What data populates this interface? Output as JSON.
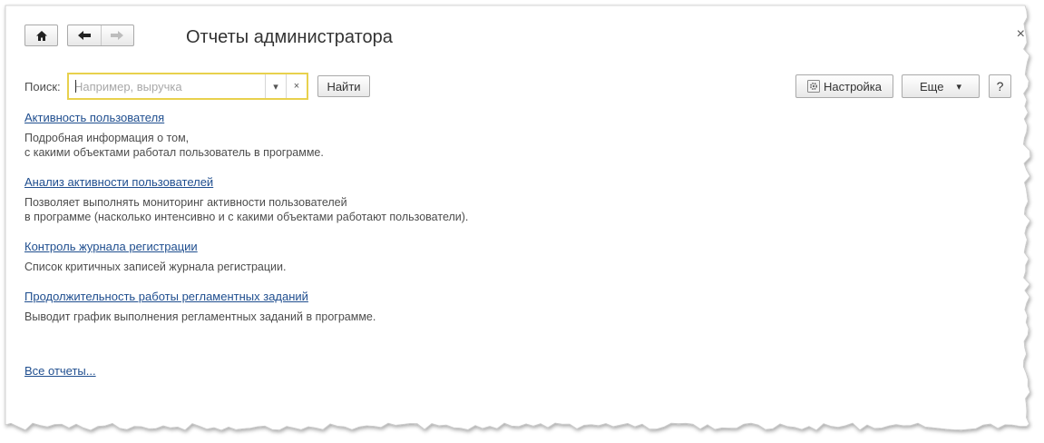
{
  "window": {
    "title": "Отчеты администратора",
    "close_glyph": "×"
  },
  "toolbar": {
    "home_icon": "home-icon",
    "back_icon": "arrow-left-icon",
    "forward_icon": "arrow-right-icon"
  },
  "search": {
    "label": "Поиск:",
    "placeholder": "Например, выручка",
    "value": "",
    "dropdown_glyph": "▾",
    "clear_glyph": "×",
    "find_label": "Найти"
  },
  "actions": {
    "settings_label": "Настройка",
    "more_label": "Еще",
    "more_glyph": "▾",
    "help_label": "?"
  },
  "reports": [
    {
      "title": "Активность пользователя",
      "description": [
        "Подробная информация о том,",
        "с какими объектами работал пользователь в программе."
      ]
    },
    {
      "title": "Анализ активности пользователей",
      "description": [
        "Позволяет выполнять мониторинг активности пользователей",
        "в программе (насколько интенсивно и с какими объектами работают пользователи)."
      ]
    },
    {
      "title": "Контроль журнала регистрации",
      "description": [
        "Список критичных записей журнала регистрации."
      ]
    },
    {
      "title": "Продолжительность работы регламентных заданий",
      "description": [
        "Выводит график выполнения регламентных заданий в программе."
      ]
    }
  ],
  "footer": {
    "all_reports_label": "Все отчеты..."
  },
  "colors": {
    "link": "#1f4e8f",
    "search_focus_border": "#e8d14d",
    "text": "#4d4d4d"
  }
}
